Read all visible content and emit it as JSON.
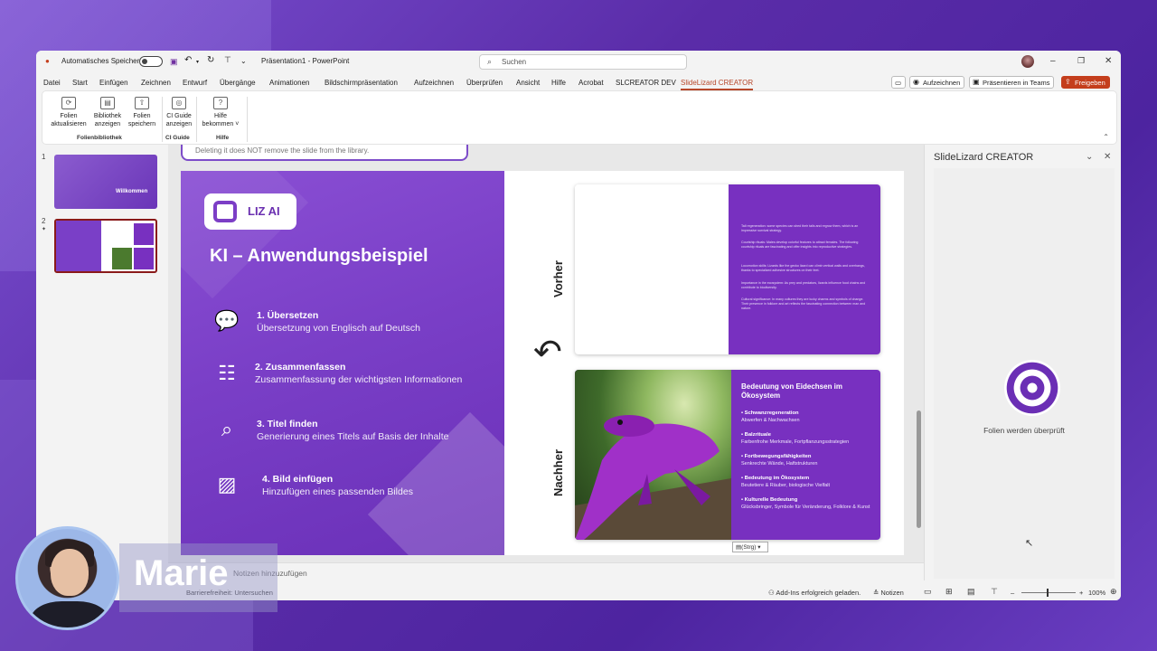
{
  "window": {
    "autosave_label": "Automatisches Speichern",
    "title": "Präsentation1 - PowerPoint",
    "search_placeholder": "Suchen"
  },
  "menu": {
    "items": [
      "Datei",
      "Start",
      "Einfügen",
      "Zeichnen",
      "Entwurf",
      "Übergänge",
      "Animationen",
      "Bildschirmpräsentation",
      "Aufzeichnen",
      "Überprüfen",
      "Ansicht",
      "Hilfe",
      "Acrobat",
      "SLCREATOR DEV",
      "SlideLizard CREATOR"
    ],
    "active": "SlideLizard CREATOR",
    "record_button": "Aufzeichnen",
    "teams_button": "Präsentieren in Teams",
    "share_button": "Freigeben"
  },
  "ribbon": {
    "buttons": [
      {
        "line1": "Folien",
        "line2": "aktualisieren"
      },
      {
        "line1": "Bibliothek",
        "line2": "anzeigen"
      },
      {
        "line1": "Folien",
        "line2": "speichern"
      },
      {
        "line1": "CI Guide",
        "line2": "anzeigen"
      },
      {
        "line1": "Hilfe",
        "line2": "bekommen ˅"
      }
    ],
    "groups": [
      "Folienbibliothek",
      "CI Guide",
      "Hilfe"
    ]
  },
  "thumbnails": {
    "slide1_num": "1",
    "slide1_text": "Willkommen",
    "slide2_num": "2"
  },
  "banner": "Deleting it does NOT remove the slide from the library.",
  "slide": {
    "logo": "LIZ AI",
    "title": "KI – Anwendungsbeispiel",
    "features": [
      {
        "heading": "1. Übersetzen",
        "desc": "Übersetzung von Englisch auf Deutsch",
        "icon": "chat-icon"
      },
      {
        "heading": "2. Zusammenfassen",
        "desc": "Zusammenfassung der wichtigsten Informationen",
        "icon": "summary-icon"
      },
      {
        "heading": "3. Titel finden",
        "desc": "Generierung eines Titels auf Basis der Inhalte",
        "icon": "search-list-icon"
      },
      {
        "heading": "4. Bild einfügen",
        "desc": "Hinzufügen eines passenden Bildes",
        "icon": "image-icon"
      }
    ],
    "before_label": "Vorher",
    "after_label": "Nachher",
    "before_text": [
      "Tail regeneration: some species can shed their tails and regrow them, which is an impressive survival strategy.",
      "Courtship rituals: Males develop colorful features to attract females. The following courtship rituals are fascinating and offer insights into reproductive strategies.",
      "Locomotion skills: Lizards like the gecko lizard can climb vertical walls and overhangs, thanks to specialized adhesive structures on their feet.",
      "Importance in the ecosystem: As prey and predators, lizards influence food chains and contribute to biodiversity.",
      "Cultural significance: In many cultures they are lucky charms and symbols of change. Their presence in folklore and art reflects the fascinating connection between man and nature."
    ],
    "after_title": "Bedeutung von Eidechsen im Ökosystem",
    "after_items": [
      {
        "head": "Schwanzregeneration",
        "text": "Abwerfen & Nachwachsen"
      },
      {
        "head": "Balzrituale",
        "text": "Farbenfrohe Merkmale, Fortpflanzungsstrategien"
      },
      {
        "head": "Fortbewegungsfähigkeiten",
        "text": "Senkrechte Wände, Haftstrukturen"
      },
      {
        "head": "Bedeutung im Ökosystem",
        "text": "Beutetiere & Räuber, biologische Vielfalt"
      },
      {
        "head": "Kulturelle Bedeutung",
        "text": "Glücksbringer, Symbole für Veränderung, Folklore & Kunst"
      }
    ],
    "paste_label": "(Strg) ▾"
  },
  "notes_placeholder": "Notizen hinzuzufügen",
  "pane": {
    "title": "SlideLizard CREATOR",
    "message": "Folien werden überprüft"
  },
  "status": {
    "accessibility": "Barrierefreiheit: Untersuchen",
    "addins": "Add-Ins erfolgreich geladen.",
    "notes": "Notizen",
    "zoom": "100%"
  },
  "presenter": {
    "name": "Marie"
  }
}
